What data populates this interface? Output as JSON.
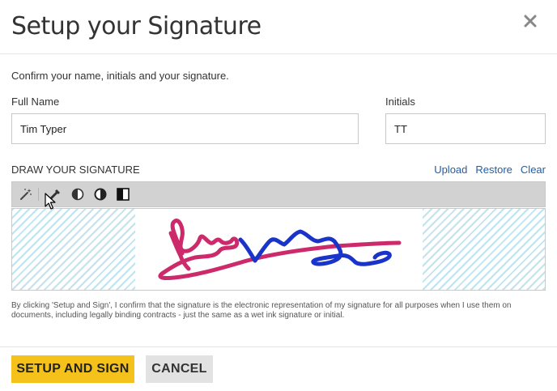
{
  "dialog": {
    "title": "Setup your Signature",
    "close_icon": "close-icon",
    "intro": "Confirm your name, initials and your signature."
  },
  "fields": {
    "full_name_label": "Full Name",
    "full_name_value": "Tim Typer",
    "initials_label": "Initials",
    "initials_value": "TT"
  },
  "signature": {
    "heading": "DRAW YOUR SIGNATURE",
    "links": {
      "upload": "Upload",
      "restore": "Restore",
      "clear": "Clear"
    },
    "tools": [
      "magic-wand-icon",
      "pen-icon",
      "contrast-low-icon",
      "contrast-high-icon",
      "contrast-toggle-icon"
    ],
    "ink_colors": {
      "primary": "#cc2a6a",
      "secondary": "#1a33c9"
    }
  },
  "disclaimer": "By clicking 'Setup and Sign', I confirm that the signature is the electronic representation of my signature for all purposes when I use them on documents, including legally binding contracts - just the same as a wet ink signature or initial.",
  "footer": {
    "primary_label": "SETUP AND SIGN",
    "cancel_label": "CANCEL"
  },
  "colors": {
    "accent": "#f5c21b",
    "link": "#1f5ea8"
  }
}
